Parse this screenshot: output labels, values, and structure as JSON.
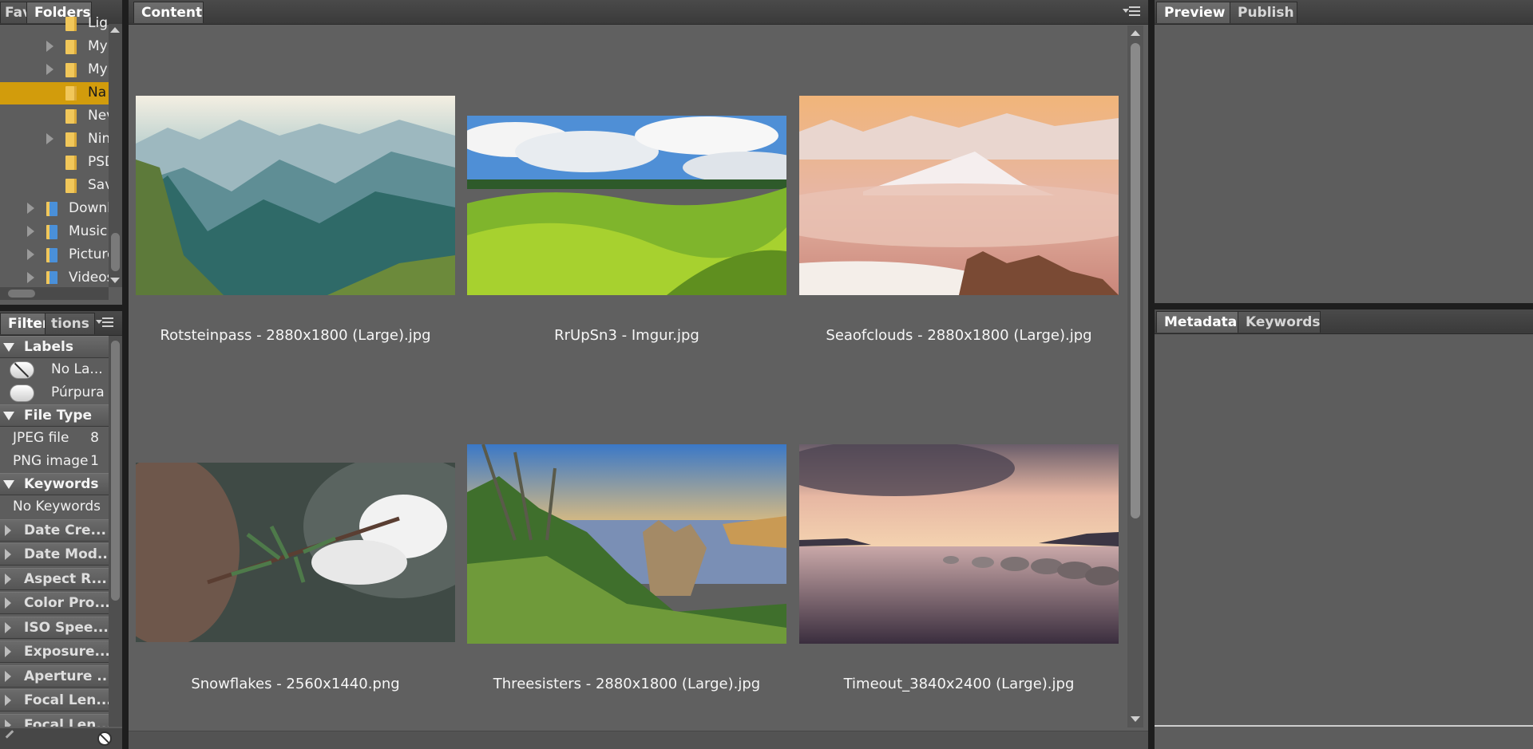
{
  "left_tabs": {
    "favorites": "Fav",
    "folders": "Folders"
  },
  "folders": [
    {
      "label": "Lig",
      "indent": 1,
      "expander": false
    },
    {
      "label": "My",
      "indent": 1,
      "expander": true
    },
    {
      "label": "My",
      "indent": 1,
      "expander": true
    },
    {
      "label": "Na",
      "indent": 1,
      "expander": false,
      "selected": true
    },
    {
      "label": "Nev",
      "indent": 1,
      "expander": false
    },
    {
      "label": "Nin",
      "indent": 1,
      "expander": true
    },
    {
      "label": "PSD",
      "indent": 1,
      "expander": false
    },
    {
      "label": "Sav",
      "indent": 1,
      "expander": false
    },
    {
      "label": "Downl",
      "indent": 0,
      "expander": true,
      "special": true
    },
    {
      "label": "Music",
      "indent": 0,
      "expander": true,
      "special": true
    },
    {
      "label": "Picture",
      "indent": 0,
      "expander": true,
      "special": true
    },
    {
      "label": "Videos",
      "indent": 0,
      "expander": true,
      "special": true
    }
  ],
  "filter_tabs": {
    "filter": "Filter",
    "collections": "tions"
  },
  "filter": {
    "labels_header": "Labels",
    "labels": [
      {
        "label": "No La...",
        "type": "none"
      },
      {
        "label": "Púrpura",
        "type": "purple"
      }
    ],
    "filetype_header": "File Type",
    "filetypes": [
      {
        "label": "JPEG file",
        "count": "8"
      },
      {
        "label": "PNG image",
        "count": "1"
      }
    ],
    "keywords_header": "Keywords",
    "keywords": [
      {
        "label": "No Keywords"
      }
    ],
    "collapsed": [
      "Date Cre...",
      "Date Mod...",
      "Aspect R...",
      "Color Pro...",
      "ISO Spee...",
      "Exposure...",
      "Aperture ...",
      "Focal Len...",
      "Focal Len..."
    ]
  },
  "content_tab": "Content",
  "thumbnails": [
    {
      "caption": "Rotsteinpass - 2880x1800 (Large).jpg",
      "kind": "mountain"
    },
    {
      "caption": "RrUpSn3 - Imgur.jpg",
      "kind": "hills"
    },
    {
      "caption": "Seaofclouds - 2880x1800 (Large).jpg",
      "kind": "clouds"
    },
    {
      "caption": "Snowflakes - 2560x1440.png",
      "kind": "snow"
    },
    {
      "caption": "Threesisters - 2880x1800 (Large).jpg",
      "kind": "sisters"
    },
    {
      "caption": "Timeout_3840x2400 (Large).jpg",
      "kind": "lake"
    }
  ],
  "right_top_tabs": {
    "preview": "Preview",
    "publish": "Publish"
  },
  "right_bottom_tabs": {
    "metadata": "Metadata",
    "keywords": "Keywords"
  }
}
